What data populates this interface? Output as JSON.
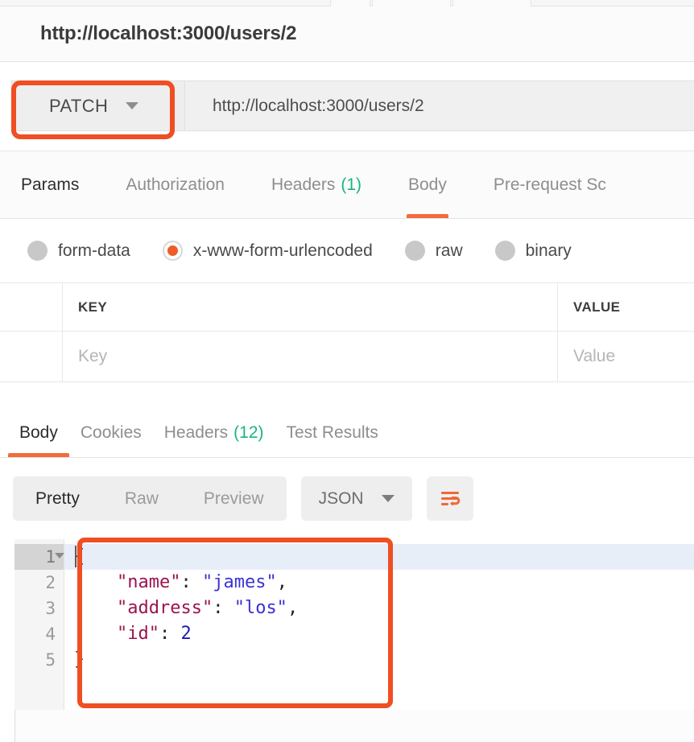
{
  "request": {
    "title": "http://localhost:3000/users/2",
    "method": "PATCH",
    "url": "http://localhost:3000/users/2",
    "method_caret_icon": "chevron-down-icon"
  },
  "request_tabs": [
    {
      "label": "Params",
      "active": false,
      "count": ""
    },
    {
      "label": "Authorization",
      "active": false,
      "count": ""
    },
    {
      "label": "Headers",
      "active": false,
      "count": "(1)"
    },
    {
      "label": "Body",
      "active": true,
      "count": ""
    },
    {
      "label": "Pre-request Sc",
      "active": false,
      "count": ""
    }
  ],
  "body_types": [
    {
      "label": "form-data",
      "selected": false
    },
    {
      "label": "x-www-form-urlencoded",
      "selected": true
    },
    {
      "label": "raw",
      "selected": false
    },
    {
      "label": "binary",
      "selected": false
    }
  ],
  "kv_table": {
    "headers": {
      "key": "KEY",
      "value": "VALUE"
    },
    "rows": [
      {
        "key_placeholder": "Key",
        "value_placeholder": "Value"
      }
    ]
  },
  "response_tabs": [
    {
      "label": "Body",
      "active": true,
      "count": ""
    },
    {
      "label": "Cookies",
      "active": false,
      "count": ""
    },
    {
      "label": "Headers",
      "active": false,
      "count": "(12)"
    },
    {
      "label": "Test Results",
      "active": false,
      "count": ""
    }
  ],
  "format_bar": {
    "segments": [
      {
        "label": "Pretty",
        "active": true
      },
      {
        "label": "Raw",
        "active": false
      },
      {
        "label": "Preview",
        "active": false
      }
    ],
    "language": "JSON",
    "language_caret_icon": "chevron-down-icon",
    "wrap_icon": "word-wrap-icon"
  },
  "response_body": {
    "line_numbers": [
      "1",
      "2",
      "3",
      "4",
      "5"
    ],
    "lines": [
      [
        {
          "t": "pun",
          "v": "{"
        }
      ],
      [
        {
          "t": "pun",
          "v": "    "
        },
        {
          "t": "key",
          "v": "\"name\""
        },
        {
          "t": "pun",
          "v": ": "
        },
        {
          "t": "str",
          "v": "\"james\""
        },
        {
          "t": "pun",
          "v": ","
        }
      ],
      [
        {
          "t": "pun",
          "v": "    "
        },
        {
          "t": "key",
          "v": "\"address\""
        },
        {
          "t": "pun",
          "v": ": "
        },
        {
          "t": "str",
          "v": "\"los\""
        },
        {
          "t": "pun",
          "v": ","
        }
      ],
      [
        {
          "t": "pun",
          "v": "    "
        },
        {
          "t": "key",
          "v": "\"id\""
        },
        {
          "t": "pun",
          "v": ": "
        },
        {
          "t": "num",
          "v": "2"
        }
      ],
      [
        {
          "t": "pun",
          "v": "}"
        }
      ]
    ]
  },
  "colors": {
    "accent": "#f26c3c",
    "annotation": "#f04e23",
    "count_green": "#1ab385",
    "json_key": "#9b1450",
    "json_string": "#3a32d2",
    "json_number": "#1b1bb3"
  }
}
